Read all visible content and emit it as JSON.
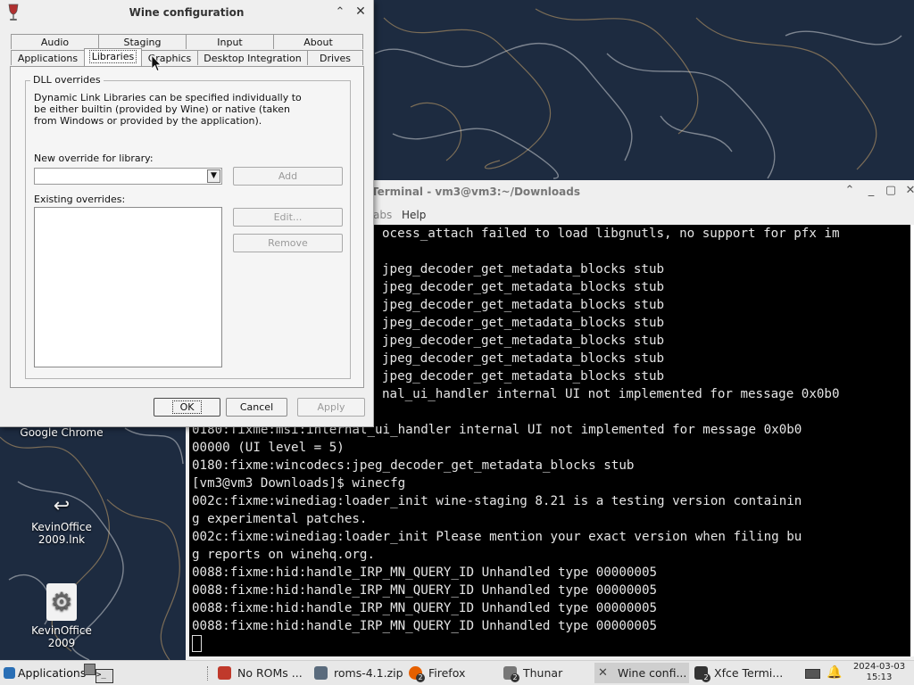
{
  "desktop": {
    "icons": [
      {
        "label": "Google Chrome"
      },
      {
        "label": "KevinOffice 2009.lnk"
      },
      {
        "label": "KevinOffice 2009"
      }
    ]
  },
  "terminal": {
    "title": "Terminal - vm3@vm3:~/Downloads",
    "menu": {
      "partial_tabs": "abs",
      "help": "Help"
    },
    "lines": [
      "ocess_attach failed to load libgnutls, no support for pfx im",
      "",
      "jpeg_decoder_get_metadata_blocks stub",
      "jpeg_decoder_get_metadata_blocks stub",
      "jpeg_decoder_get_metadata_blocks stub",
      "jpeg_decoder_get_metadata_blocks stub",
      "jpeg_decoder_get_metadata_blocks stub",
      "jpeg_decoder_get_metadata_blocks stub",
      "jpeg_decoder_get_metadata_blocks stub",
      "nal_ui_handler internal UI not implemented for message 0x0b0",
      "",
      "0180:fixme:msi:internal_ui_handler internal UI not implemented for message 0x0b0",
      "00000 (UI level = 5)",
      "0180:fixme:wincodecs:jpeg_decoder_get_metadata_blocks stub",
      "[vm3@vm3 Downloads]$ winecfg",
      "002c:fixme:winediag:loader_init wine-staging 8.21 is a testing version containin",
      "g experimental patches.",
      "002c:fixme:winediag:loader_init Please mention your exact version when filing bu",
      "g reports on winehq.org.",
      "0088:fixme:hid:handle_IRP_MN_QUERY_ID Unhandled type 00000005",
      "0088:fixme:hid:handle_IRP_MN_QUERY_ID Unhandled type 00000005",
      "0088:fixme:hid:handle_IRP_MN_QUERY_ID Unhandled type 00000005",
      "0088:fixme:hid:handle_IRP_MN_QUERY_ID Unhandled type 00000005",
      ""
    ]
  },
  "wine": {
    "title": "Wine configuration",
    "tabs_row1": [
      "Audio",
      "Staging",
      "Input",
      "About"
    ],
    "tabs_row2": [
      "Applications",
      "Libraries",
      "Graphics",
      "Desktop Integration",
      "Drives"
    ],
    "selected_tab": "Libraries",
    "group_title": "DLL overrides",
    "description": "Dynamic Link Libraries can be specified individually to be either builtin (provided by Wine) or native (taken from Windows or provided by the application).",
    "new_override_label": "New override for library:",
    "combo_value": "",
    "add_label": "Add",
    "existing_label": "Existing overrides:",
    "edit_label": "Edit...",
    "remove_label": "Remove",
    "ok_label": "OK",
    "cancel_label": "Cancel",
    "apply_label": "Apply"
  },
  "taskbar": {
    "applications": "Applications",
    "tasks": [
      {
        "label": "No ROMs ...",
        "icon": "game-icon",
        "color": "#c0392b"
      },
      {
        "label": "roms-4.1.zip",
        "icon": "archive-icon",
        "color": "#5a6b7d"
      },
      {
        "label": "Firefox",
        "icon": "firefox-icon",
        "color": "#e66000",
        "badge": "2"
      },
      {
        "label": "Thunar",
        "icon": "folder-icon",
        "color": "#777777",
        "badge": "2"
      },
      {
        "label": "Wine confi...",
        "icon": "wine-tools-icon",
        "color": "#555555"
      },
      {
        "label": "Xfce Termi...",
        "icon": "terminal-icon",
        "color": "#333333",
        "badge": "2"
      }
    ],
    "clock_date": "2024-03-03",
    "clock_time": "15:13"
  }
}
